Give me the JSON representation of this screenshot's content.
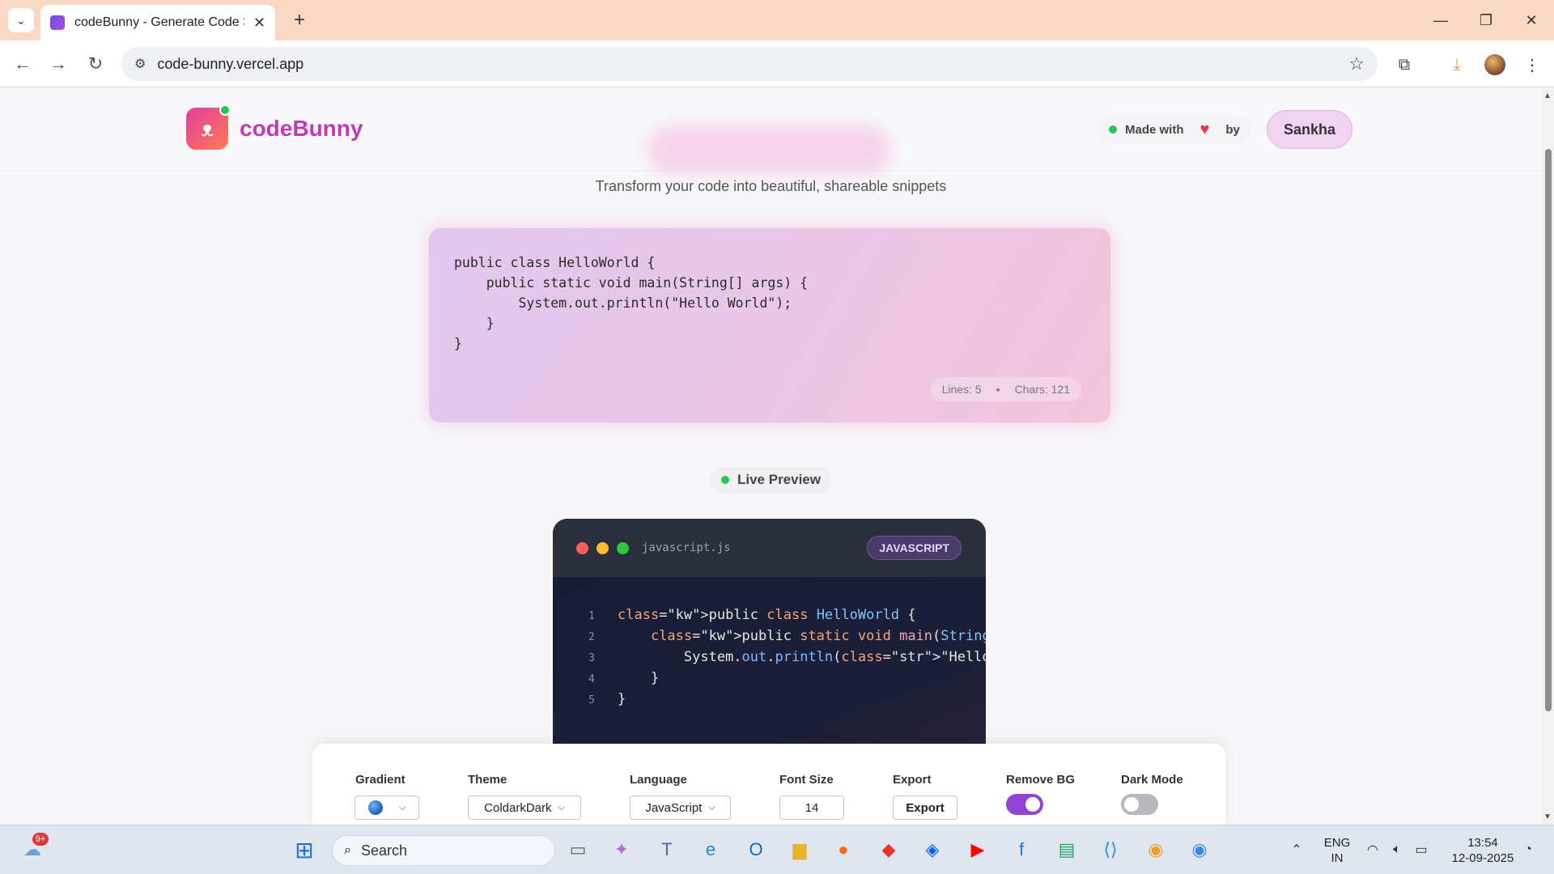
{
  "browser": {
    "tab_title": "codeBunny - Generate Code Sn",
    "url": "code-bunny.vercel.app"
  },
  "header": {
    "brand": "codeBunny",
    "made_with": "Made with",
    "by": "by",
    "author": "Sankha"
  },
  "subtitle": "Transform your code into beautiful, shareable snippets",
  "editor": {
    "code": "public class HelloWorld {\n    public static void main(String[] args) {\n        System.out.println(\"Hello World\");\n    }\n}",
    "lines_label": "Lines: 5",
    "chars_label": "Chars: 121"
  },
  "live_preview_label": "Live Preview",
  "preview": {
    "filename": "javascript.js",
    "language_badge": "JAVASCRIPT",
    "line_numbers": [
      "1",
      "2",
      "3",
      "4",
      "5"
    ]
  },
  "controls": {
    "gradient_label": "Gradient",
    "theme_label": "Theme",
    "theme_value": "ColdarkDark",
    "language_label": "Language",
    "language_value": "JavaScript",
    "font_size_label": "Font Size",
    "font_size_value": "14",
    "export_label": "Export",
    "export_button": "Export",
    "remove_bg_label": "Remove BG",
    "remove_bg_on": true,
    "dark_mode_label": "Dark Mode",
    "dark_mode_on": false
  },
  "taskbar": {
    "search_text": "Search",
    "weather_badge": "9+",
    "lang_line1": "ENG",
    "lang_line2": "IN",
    "time": "13:54",
    "date": "12-09-2025"
  },
  "colors": {
    "brand": "#c03bb7",
    "toggle_on": "#8e45d6",
    "toggle_off": "#b8b8be",
    "live": "#27c65a"
  }
}
